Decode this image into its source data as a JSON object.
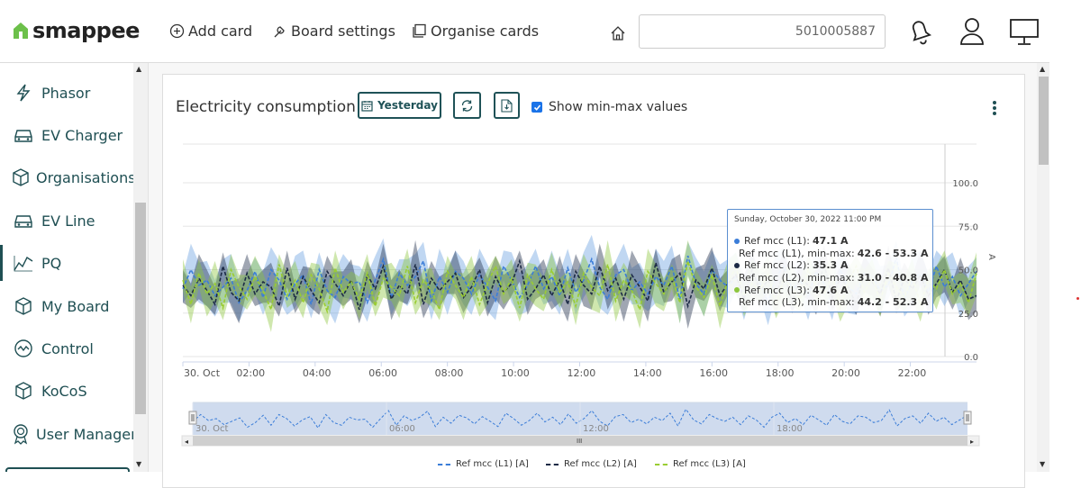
{
  "brand": {
    "name": "smappee",
    "color": "#6cc04a"
  },
  "toolbar": {
    "add_card": "Add card",
    "board_settings": "Board settings",
    "organise_cards": "Organise cards",
    "search_value": "5010005887"
  },
  "sidebar": {
    "items": [
      {
        "label": "Phasor",
        "icon": "lightning-icon"
      },
      {
        "label": "EV Charger",
        "icon": "car-icon"
      },
      {
        "label": "Organisations",
        "icon": "cube-icon"
      },
      {
        "label": "EV Line",
        "icon": "car-icon"
      },
      {
        "label": "PQ",
        "icon": "line-chart-icon",
        "active": true
      },
      {
        "label": "My Board",
        "icon": "cube-icon"
      },
      {
        "label": "Control",
        "icon": "gauge-icon"
      },
      {
        "label": "KoCoS",
        "icon": "cube-icon"
      },
      {
        "label": "User Managem",
        "icon": "award-icon"
      }
    ]
  },
  "card": {
    "title": "Electricity consumption",
    "period_button": "Yesterday",
    "show_minmax_label": "Show min-max values",
    "show_minmax_checked": true
  },
  "tooltip": {
    "date": "Sunday, October 30, 2022 11:00 PM",
    "rows": [
      {
        "label": "Ref mcc (L1):",
        "value": "47.1 A",
        "color": "#3b7dd8"
      },
      {
        "label": "Ref mcc (L1), min-max:",
        "value": "42.6 - 53.3 A",
        "color": "#3b7dd8"
      },
      {
        "label": "Ref mcc (L2):",
        "value": "35.3 A",
        "color": "#1c2a45"
      },
      {
        "label": "Ref mcc (L2), min-max:",
        "value": "31.0 - 40.8 A",
        "color": "#1c2a45"
      },
      {
        "label": "Ref mcc (L3):",
        "value": "47.6 A",
        "color": "#8dc63f"
      },
      {
        "label": "Ref mcc (L3), min-max:",
        "value": "44.2 - 52.3 A",
        "color": "#8dc63f"
      }
    ]
  },
  "chart_data": {
    "type": "line",
    "title": "",
    "xlabel": "",
    "ylabel": "A",
    "ylim": [
      0,
      100
    ],
    "y_ticks": [
      "0.0",
      "25.0",
      "50.0",
      "75.0",
      "100.0"
    ],
    "x_ticks": [
      "30. Oct",
      "02:00",
      "04:00",
      "06:00",
      "08:00",
      "10:00",
      "12:00",
      "14:00",
      "16:00",
      "18:00",
      "20:00",
      "22:00"
    ],
    "navigator_labels": [
      "30. Oct",
      "06:00",
      "12:00",
      "18:00"
    ],
    "x_range_hours": [
      0,
      24
    ],
    "grid": true,
    "legend_position": "bottom",
    "series": [
      {
        "name": "Ref mcc (L1) [A]",
        "color": "#3b7dd8",
        "band_color": "#6a9fe0",
        "values": [
          39,
          50,
          41,
          44,
          35,
          40,
          45,
          31,
          38,
          49,
          34,
          50,
          44,
          33,
          42,
          47,
          30,
          50,
          38,
          34,
          46,
          42,
          43,
          31,
          44,
          56,
          34,
          48,
          41,
          46,
          55,
          32,
          46,
          37,
          49,
          45,
          36,
          47,
          40,
          32,
          52,
          44,
          34,
          41,
          52,
          39,
          46,
          35,
          51,
          37,
          44,
          56,
          40,
          33,
          47,
          50,
          38,
          43,
          36,
          46,
          41,
          52,
          33,
          58,
          42,
          36,
          50,
          44,
          40,
          46,
          35,
          48,
          42,
          31,
          46,
          52,
          38,
          44,
          35,
          49,
          42,
          34,
          50,
          40,
          36,
          48,
          46,
          38,
          41,
          57,
          33,
          44,
          48,
          37,
          52,
          40,
          46,
          35,
          42,
          49
        ]
      },
      {
        "name": "Ref mcc (L2) [A]",
        "color": "#1c2a45",
        "band_color": "#2c3a55",
        "values": [
          41,
          35,
          45,
          38,
          30,
          52,
          37,
          32,
          48,
          36,
          43,
          40,
          29,
          51,
          33,
          46,
          38,
          31,
          49,
          42,
          35,
          44,
          27,
          47,
          39,
          52,
          33,
          41,
          36,
          53,
          30,
          45,
          38,
          43,
          48,
          34,
          40,
          50,
          31,
          46,
          37,
          42,
          55,
          33,
          39,
          47,
          35,
          44,
          30,
          49,
          41,
          36,
          52,
          38,
          45,
          33,
          47,
          40,
          32,
          54,
          37,
          43,
          48,
          29,
          44,
          39,
          51,
          35,
          42,
          47,
          33,
          50,
          38,
          44,
          36,
          49,
          31,
          46,
          41,
          37,
          53,
          34,
          45,
          40,
          30,
          48,
          43,
          36,
          51,
          32,
          45,
          39,
          47,
          35,
          42,
          50,
          37,
          44,
          33,
          35
        ]
      },
      {
        "name": "Ref mcc (L3) [A]",
        "color": "#9acd32",
        "band_color": "#8dc63f",
        "values": [
          44,
          30,
          48,
          36,
          42,
          28,
          50,
          40,
          33,
          46,
          38,
          27,
          53,
          35,
          44,
          31,
          47,
          39,
          26,
          51,
          37,
          43,
          33,
          48,
          29,
          45,
          40,
          35,
          52,
          31,
          44,
          38,
          27,
          49,
          41,
          34,
          46,
          30,
          42,
          52,
          36,
          45,
          28,
          47,
          39,
          33,
          50,
          37,
          43,
          29,
          48,
          40,
          35,
          53,
          32,
          44,
          38,
          27,
          49,
          42,
          36,
          46,
          31,
          55,
          40,
          34,
          47,
          29,
          44,
          51,
          35,
          42,
          38,
          48,
          30,
          45,
          39,
          33,
          50,
          41,
          36,
          47,
          28,
          43,
          52,
          37,
          45,
          32,
          48,
          40,
          34,
          46,
          30,
          44,
          39,
          50,
          36,
          42,
          31,
          48
        ]
      }
    ]
  }
}
